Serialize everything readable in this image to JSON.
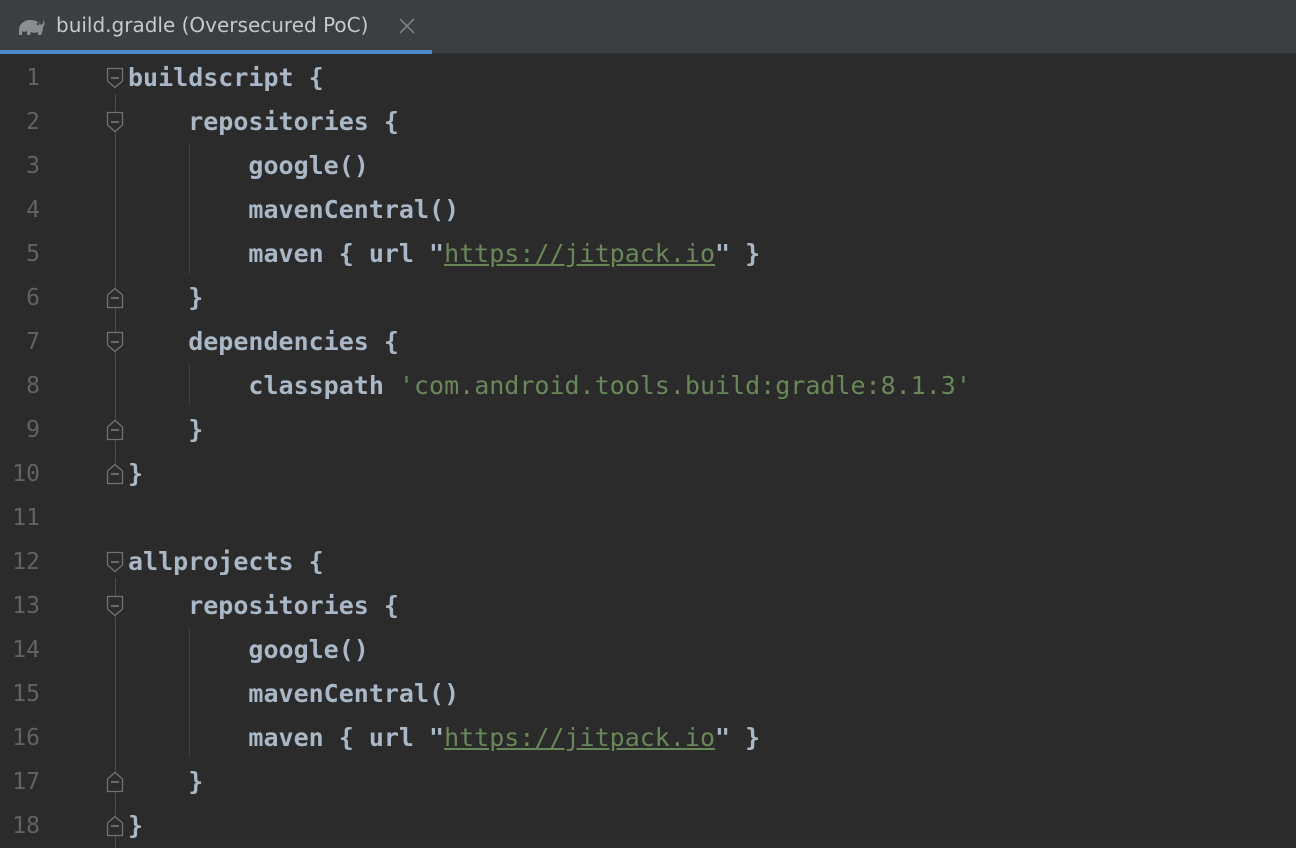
{
  "tab": {
    "title": "build.gradle (Oversecured PoC)",
    "icon": "gradle-elephant-icon",
    "close_icon": "close-icon",
    "accent_color": "#4a88c7"
  },
  "editor": {
    "lines": [
      {
        "num": "1",
        "text": "buildscript {"
      },
      {
        "num": "2",
        "text": "    repositories {"
      },
      {
        "num": "3",
        "text": "        google()"
      },
      {
        "num": "4",
        "text": "        mavenCentral()"
      },
      {
        "num": "5",
        "pre": "        maven { url \"",
        "link": "https://jitpack.io",
        "post": "\" }"
      },
      {
        "num": "6",
        "text": "    }"
      },
      {
        "num": "7",
        "text": "    dependencies {"
      },
      {
        "num": "8",
        "pre": "        classpath ",
        "str": "'com.android.tools.build:gradle:8.1.3'"
      },
      {
        "num": "9",
        "text": "    }"
      },
      {
        "num": "10",
        "text": "}"
      },
      {
        "num": "11",
        "text": ""
      },
      {
        "num": "12",
        "text": "allprojects {"
      },
      {
        "num": "13",
        "text": "    repositories {"
      },
      {
        "num": "14",
        "text": "        google()"
      },
      {
        "num": "15",
        "text": "        mavenCentral()"
      },
      {
        "num": "16",
        "pre": "        maven { url \"",
        "link": "https://jitpack.io",
        "post": "\" }"
      },
      {
        "num": "17",
        "text": "    }"
      },
      {
        "num": "18",
        "text": "}"
      }
    ]
  },
  "colors": {
    "background": "#2b2b2b",
    "text": "#a9b7c6",
    "string": "#6a8759",
    "line_number": "#606366"
  }
}
